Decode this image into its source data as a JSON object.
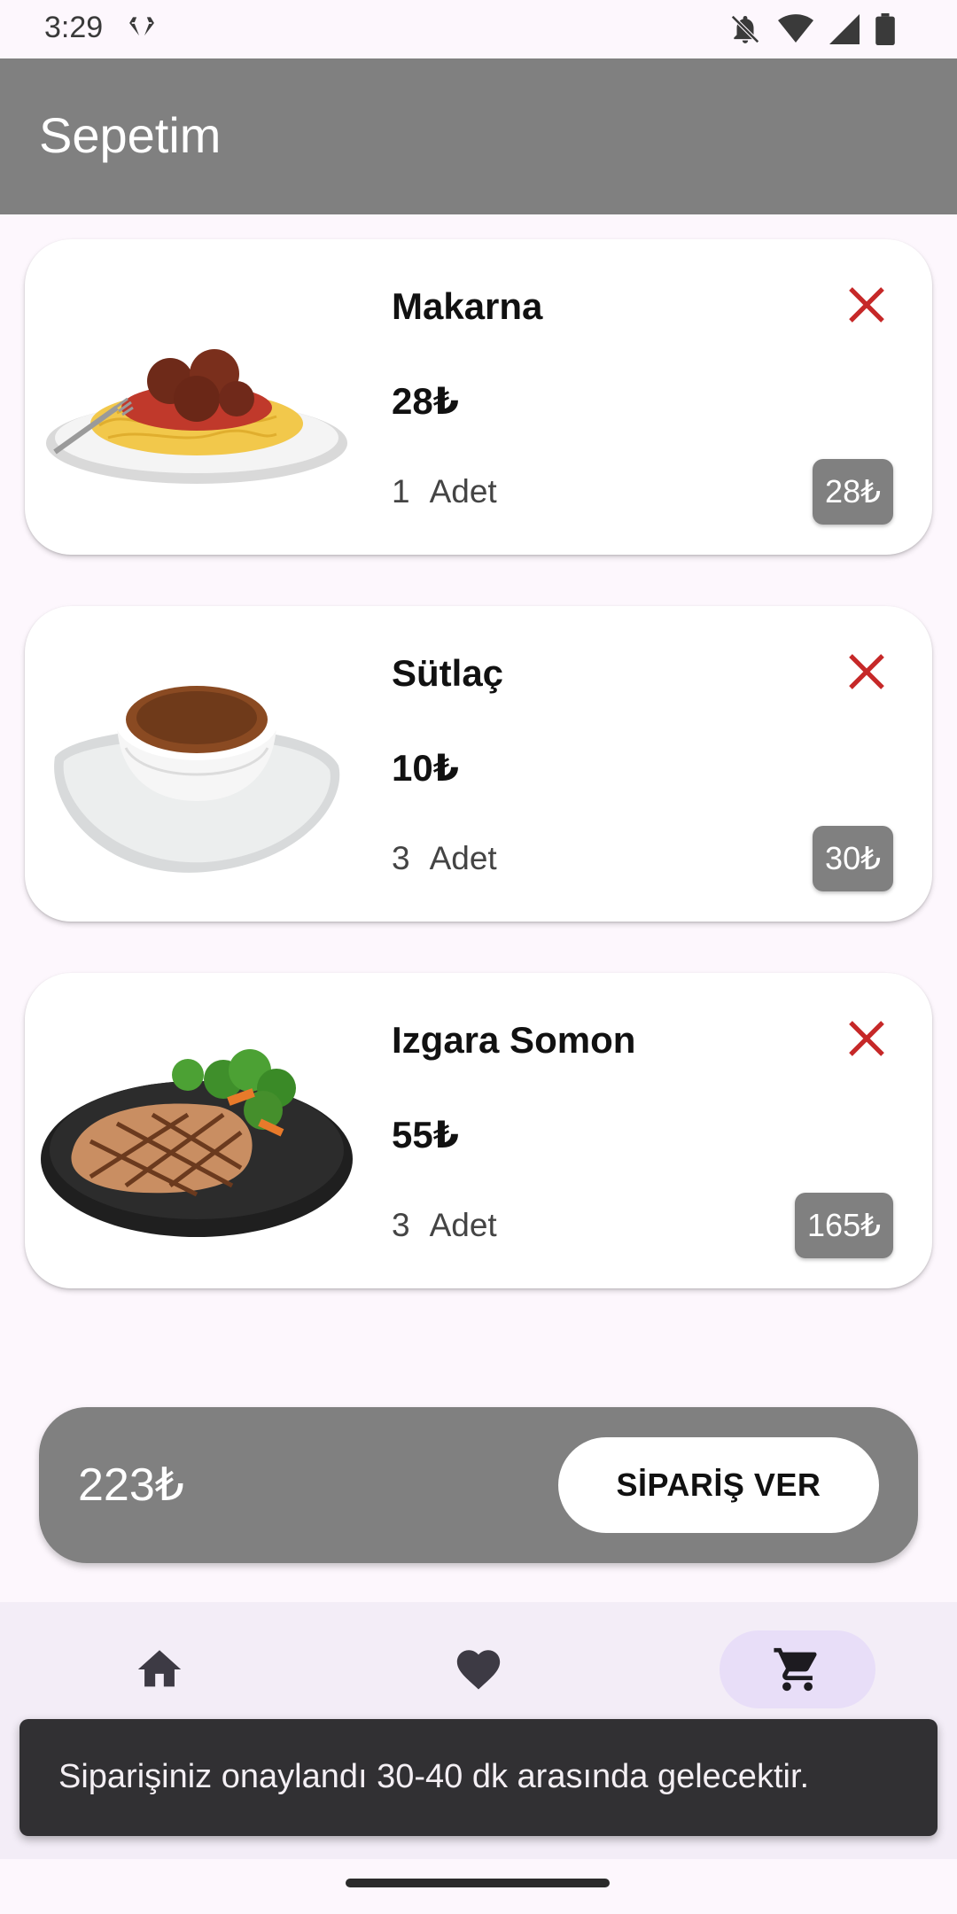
{
  "status_bar": {
    "time": "3:29",
    "icons": [
      "gem-icon",
      "notifications-off-icon",
      "wifi-icon",
      "signal-icon",
      "battery-icon"
    ]
  },
  "app_bar": {
    "title": "Sepetim"
  },
  "cart": {
    "items": [
      {
        "name": "Makarna",
        "price": "28₺",
        "quantity": "1",
        "unit": "Adet",
        "line_total": "28₺",
        "image": "spaghetti-meatballs-image"
      },
      {
        "name": "Sütlaç",
        "price": "10₺",
        "quantity": "3",
        "unit": "Adet",
        "line_total": "30₺",
        "image": "rice-pudding-image"
      },
      {
        "name": "Izgara Somon",
        "price": "55₺",
        "quantity": "3",
        "unit": "Adet",
        "line_total": "165₺",
        "image": "grilled-salmon-image"
      }
    ]
  },
  "total_bar": {
    "total": "223₺",
    "order_button": "SİPARİŞ VER"
  },
  "bottom_nav": {
    "items": [
      {
        "icon": "home-icon",
        "active": false
      },
      {
        "icon": "heart-icon",
        "active": false
      },
      {
        "icon": "cart-icon",
        "active": true
      }
    ]
  },
  "snackbar": {
    "message": "Siparişiniz onaylandı 30-40 dk arasında gelecektir."
  },
  "colors": {
    "background": "#FDF7FD",
    "app_bar": "#808080",
    "remove_icon": "#C62828",
    "nav_bar": "#F3EDF7",
    "nav_active": "#E8DEF8",
    "snackbar": "#313033"
  }
}
